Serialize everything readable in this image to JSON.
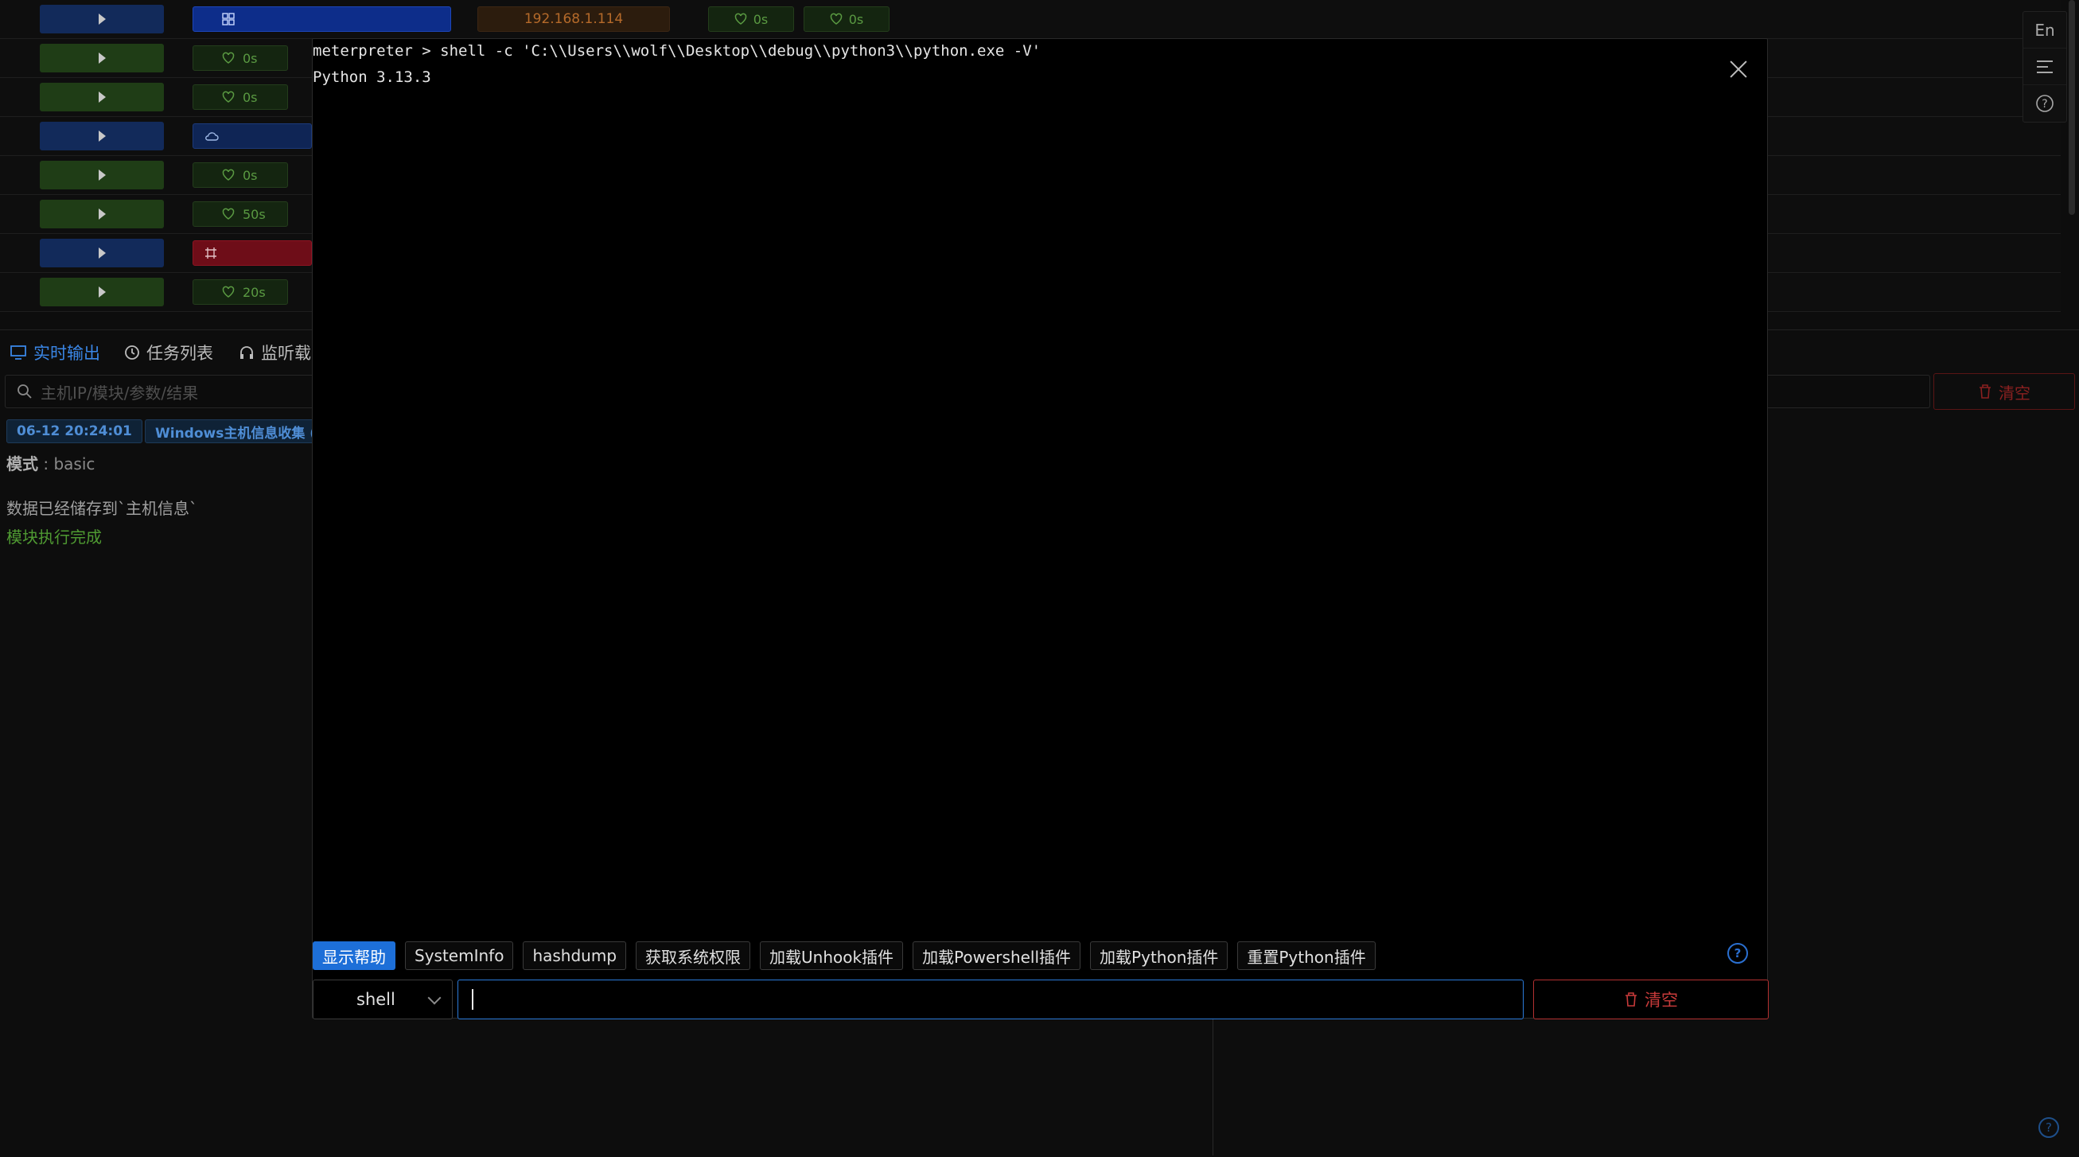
{
  "hosts": [
    {
      "expand": "blue",
      "tag_style": "wide",
      "tag_text": "",
      "ip": "192.168.1.114",
      "hb1": "0s",
      "hb2": "0s"
    },
    {
      "expand": "green",
      "tag_style": "green",
      "tag_text": "0s"
    },
    {
      "expand": "green",
      "tag_style": "green",
      "tag_text": "0s"
    },
    {
      "expand": "blue",
      "tag_style": "blue",
      "tag_text": ""
    },
    {
      "expand": "green",
      "tag_style": "green",
      "tag_text": "0s"
    },
    {
      "expand": "green",
      "tag_style": "green",
      "tag_text": "50s"
    },
    {
      "expand": "blue",
      "tag_style": "red",
      "tag_text": ""
    },
    {
      "expand": "green",
      "tag_style": "green",
      "tag_text": "20s"
    }
  ],
  "right_tools": {
    "lang": "En"
  },
  "bottom_tabs": [
    {
      "label": "实时输出"
    },
    {
      "label": "任务列表"
    },
    {
      "label": "监听载"
    }
  ],
  "search": {
    "placeholder": "主机IP/模块/参数/结果"
  },
  "background_clear": "清空",
  "log": {
    "time": "06-12 20:24:01",
    "module": "Windows主机信息收集 (",
    "mode_label": "模式",
    "mode_value": ": basic",
    "saved": "数据已经储存到`主机信息`",
    "done": "模块执行完成"
  },
  "console": {
    "lines": [
      "meterpreter > shell -c 'C:\\\\Users\\\\wolf\\\\Desktop\\\\debug\\\\python3\\\\python.exe -V'",
      "Python 3.13.3"
    ]
  },
  "quick_commands": [
    {
      "label": "显示帮助",
      "primary": true
    },
    {
      "label": "SystemInfo"
    },
    {
      "label": "hashdump"
    },
    {
      "label": "获取系统权限"
    },
    {
      "label": "加载Unhook插件"
    },
    {
      "label": "加载Powershell插件"
    },
    {
      "label": "加载Python插件"
    },
    {
      "label": "重置Python插件"
    }
  ],
  "command": {
    "type": "shell",
    "value": "",
    "clear_label": "清空"
  },
  "colors": {
    "accent": "#1d6fd8",
    "danger": "#c83a3a",
    "success": "#4f9a32"
  }
}
